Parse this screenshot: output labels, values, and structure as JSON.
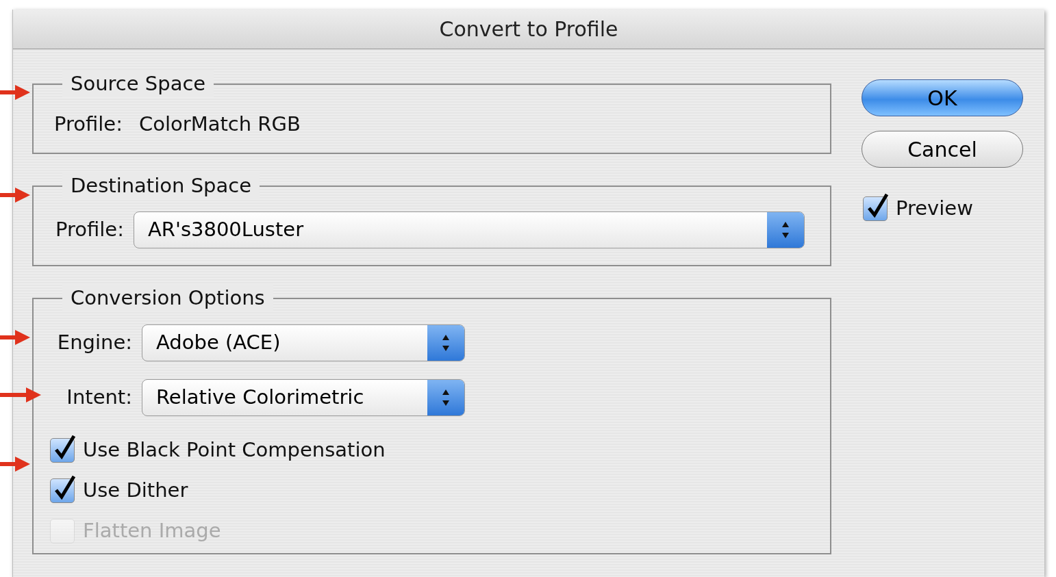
{
  "window": {
    "title": "Convert to Profile"
  },
  "source_space": {
    "legend": "Source Space",
    "profile_label": "Profile:",
    "profile": "ColorMatch RGB"
  },
  "destination_space": {
    "legend": "Destination Space",
    "profile_label": "Profile:",
    "profile": "AR's3800Luster"
  },
  "conversion_options": {
    "legend": "Conversion Options",
    "selects": [
      {
        "label": "Engine:",
        "value": "Adobe (ACE)"
      },
      {
        "label": "Intent:",
        "value": "Relative Colorimetric"
      }
    ],
    "checkboxes": [
      {
        "label": "Use Black Point Compensation",
        "checked": true,
        "disabled": false
      },
      {
        "label": "Use Dither",
        "checked": true,
        "disabled": false
      },
      {
        "label": "Flatten Image",
        "checked": false,
        "disabled": true
      }
    ]
  },
  "buttons": [
    {
      "label": "OK",
      "default": true
    },
    {
      "label": "Cancel",
      "default": false
    }
  ],
  "preview": {
    "label": "Preview",
    "checked": true
  }
}
